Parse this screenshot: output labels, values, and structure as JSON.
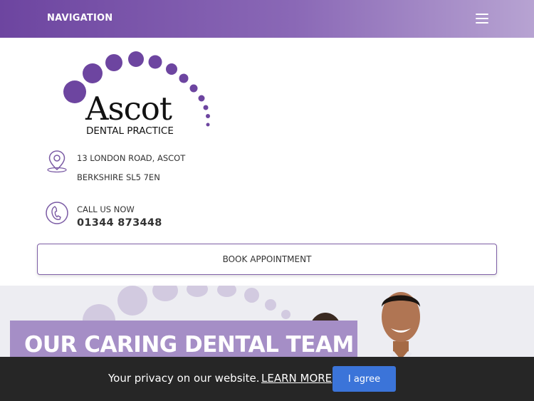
{
  "nav": {
    "label": "NAVIGATION",
    "menu_icon": "hamburger-menu-icon"
  },
  "logo": {
    "word": "Ascot",
    "subtitle": "DENTAL PRACTICE"
  },
  "address": {
    "icon": "map-pin-icon",
    "line1": "13 LONDON ROAD, ASCOT",
    "line2": "BERKSHIRE SL5 7EN"
  },
  "call": {
    "icon": "phone-icon",
    "label": "CALL US NOW",
    "number": "01344 873448"
  },
  "book_button": "BOOK APPOINTMENT",
  "hero": {
    "title": "OUR CARING DENTAL TEAM"
  },
  "cookie": {
    "text": "Your privacy on our website.",
    "link": "LEARN MORE",
    "button": "I agree"
  },
  "colors": {
    "brand_purple": "#6d45a0",
    "banner_purple": "#a58ec6",
    "button_blue": "#3b74d9",
    "cookie_bg": "#262626"
  }
}
